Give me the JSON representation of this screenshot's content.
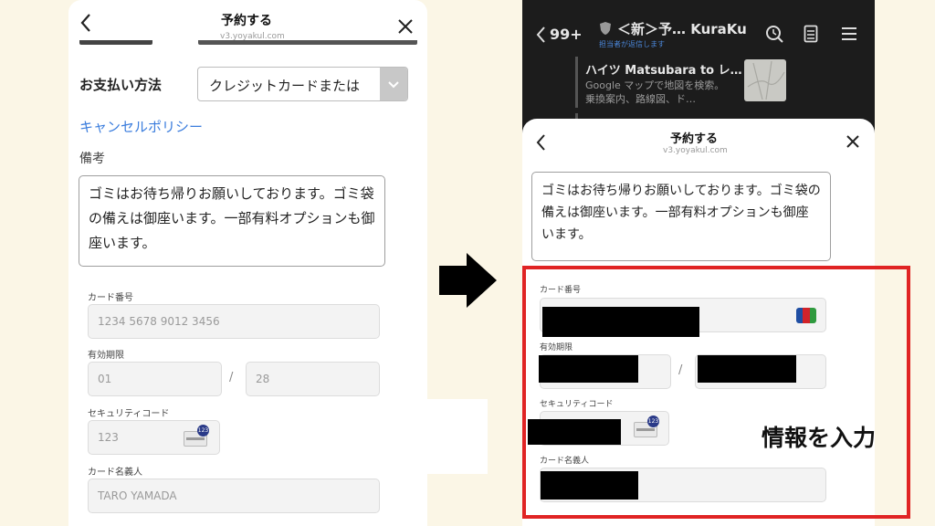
{
  "left": {
    "title": "予約する",
    "url": "v3.yoyakul.com",
    "payment_label": "お支払い方法",
    "payment_value": "クレジットカードまたは",
    "cancel_policy": "キャンセルポリシー",
    "remarks_label": "備考",
    "remarks_text": "ゴミはお待ち帰りお願いしております。ゴミ袋の備えは御座います。一部有料オプションも御座います。",
    "card_number_label": "カード番号",
    "card_number_placeholder": "1234 5678 9012 3456",
    "expiry_label": "有効期限",
    "expiry_month_placeholder": "01",
    "expiry_slash": "/",
    "expiry_year_placeholder": "28",
    "security_label": "セキュリティコード",
    "security_placeholder": "123",
    "security_badge": "123",
    "holder_label": "カード名義人",
    "holder_placeholder": "TARO YAMADA"
  },
  "right": {
    "topbar": {
      "back_count": "99+",
      "chat_title": "＜新＞予… KuraKu",
      "chat_subtitle": "担当者が返信します"
    },
    "message": {
      "title": "ハイツ Matsubara to レ…",
      "desc": "Google マップで地図を検索。乗換案内、路線図、ド…"
    },
    "title": "予約する",
    "url": "v3.yoyakul.com",
    "remarks_text": "ゴミはお待ち帰りお願いしております。ゴミ袋の備えは御座います。一部有料オプションも御座います。",
    "card_number_label": "カード番号",
    "expiry_label": "有効期限",
    "expiry_slash": "/",
    "security_label": "セキュリティコード",
    "security_badge": "123",
    "holder_label": "カード名義人",
    "annotation": "情報を入力",
    "card_brand": "JCB"
  },
  "colors": {
    "background": "#fbf6e6",
    "highlight_red": "#e02424",
    "link_blue": "#3b7ddd"
  }
}
